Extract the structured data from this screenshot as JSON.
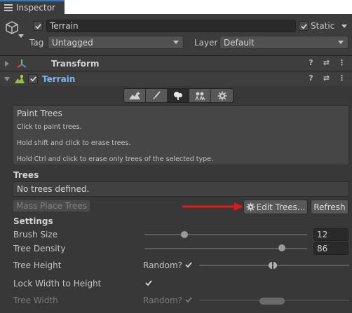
{
  "tab": {
    "title": "Inspector"
  },
  "gameobject": {
    "name": "Terrain",
    "static_label": "Static",
    "tag_label": "Tag",
    "tag_value": "Untagged",
    "layer_label": "Layer",
    "layer_value": "Default",
    "active": true,
    "static": true
  },
  "components": {
    "transform": {
      "title": "Transform"
    },
    "terrain": {
      "title": "Terrain",
      "title_color": "#7db3f0",
      "enabled": true
    }
  },
  "tools": [
    "raise-lower-terrain-icon",
    "paint-texture-icon",
    "paint-trees-icon",
    "paint-details-icon",
    "terrain-settings-icon"
  ],
  "helpbox": {
    "title": "Paint Trees",
    "line1": "Click to paint trees.",
    "line2": "Hold shift and click to erase trees.",
    "line3": "Hold Ctrl and click to erase only trees of the selected type."
  },
  "trees": {
    "section_title": "Trees",
    "empty_text": "No trees defined.",
    "mass_place_label": "Mass Place Trees",
    "edit_trees_label": "Edit Trees...",
    "refresh_label": "Refresh",
    "arrow_color": "#e01a1a"
  },
  "settings": {
    "section_title": "Settings",
    "brush_size_label": "Brush Size",
    "brush_size_value": "12",
    "tree_density_label": "Tree Density",
    "tree_density_value": "86",
    "tree_height_label": "Tree Height",
    "random_label": "Random?",
    "tree_height_random": true,
    "lock_width_label": "Lock Width to Height",
    "lock_width_checked": true,
    "tree_width_label": "Tree Width",
    "tree_width_random_label": "Random?",
    "tree_width_random": true
  }
}
